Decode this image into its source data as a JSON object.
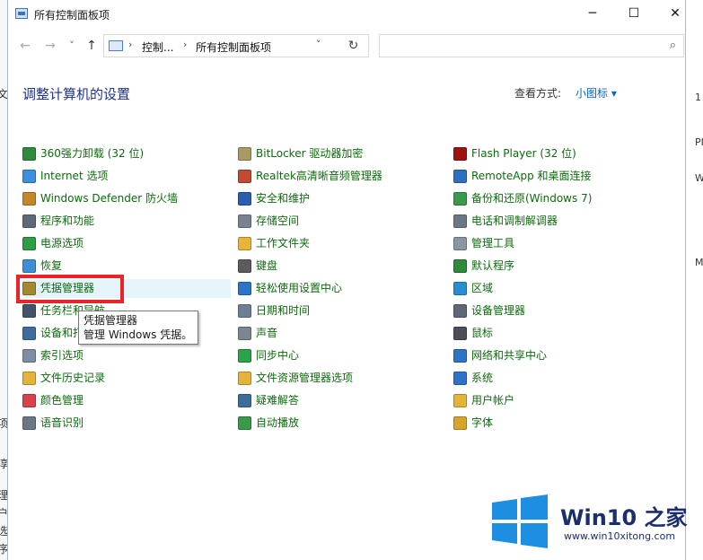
{
  "window": {
    "title": "所有控制面板项",
    "minimize": "─",
    "maximize": "☐",
    "close": "✕"
  },
  "nav": {
    "back": "←",
    "forward": "→",
    "recent": "˅",
    "up": "↑",
    "breadcrumb": [
      "控制...",
      "所有控制面板项"
    ],
    "separator": "›",
    "dropdown": "˅",
    "refresh": "↻",
    "search_placeholder": "",
    "search_icon": "⌕"
  },
  "header": {
    "title": "调整计算机的设置",
    "view_by_label": "查看方式:",
    "view_by_value": "小图标 ▾"
  },
  "items": [
    [
      "360强力卸载 (32 位)",
      "Internet 选项",
      "Windows Defender 防火墙",
      "程序和功能",
      "电源选项",
      "恢复",
      "凭据管理器",
      "任务栏和导航",
      "设备和打印机",
      "索引选项",
      "文件历史记录",
      "颜色管理",
      "语音识别"
    ],
    [
      "BitLocker 驱动器加密",
      "Realtek高清晰音频管理器",
      "安全和维护",
      "存储空间",
      "工作文件夹",
      "键盘",
      "轻松使用设置中心",
      "日期和时间",
      "声音",
      "同步中心",
      "文件资源管理器选项",
      "疑难解答",
      "自动播放"
    ],
    [
      "Flash Player (32 位)",
      "RemoteApp 和桌面连接",
      "备份和还原(Windows 7)",
      "电话和调制解调器",
      "管理工具",
      "默认程序",
      "区域",
      "设备管理器",
      "鼠标",
      "网络和共享中心",
      "系统",
      "用户帐户",
      "字体"
    ]
  ],
  "icons": [
    [
      "uninstall-icon",
      "internet-options-icon",
      "firewall-icon",
      "programs-icon",
      "power-icon",
      "recovery-icon",
      "credential-icon",
      "taskbar-icon",
      "printer-icon",
      "index-icon",
      "file-history-icon",
      "color-icon",
      "speech-icon"
    ],
    [
      "bitlocker-icon",
      "audio-manager-icon",
      "security-flag-icon",
      "storage-icon",
      "work-folders-icon",
      "keyboard-icon",
      "ease-of-access-icon",
      "date-time-icon",
      "sound-icon",
      "sync-icon",
      "explorer-options-icon",
      "troubleshoot-icon",
      "autoplay-icon"
    ],
    [
      "flash-icon",
      "remoteapp-icon",
      "backup-icon",
      "phone-modem-icon",
      "admin-tools-icon",
      "default-programs-icon",
      "region-icon",
      "device-manager-icon",
      "mouse-icon",
      "network-icon",
      "system-icon",
      "user-accounts-icon",
      "fonts-icon"
    ]
  ],
  "icon_colors": [
    [
      "#2f8a3a",
      "#3c8fdf",
      "#c4862b",
      "#5f6a78",
      "#2f9d44",
      "#3d8fd6",
      "#a5882f",
      "#44536a",
      "#3d6d9c",
      "#7e8ea2",
      "#e3b33a",
      "#d8424a",
      "#6b7786"
    ],
    [
      "#a99a64",
      "#c24a33",
      "#2a5fb0",
      "#7a8291",
      "#e7b43c",
      "#5c5c5c",
      "#2d74c8",
      "#6e7f95",
      "#7d8592",
      "#2aa34a",
      "#e3b33a",
      "#3d6d9c",
      "#3a9a4b"
    ],
    [
      "#9b1410",
      "#2f6fc0",
      "#3a9a4b",
      "#6b7786",
      "#8b96a4",
      "#2f8a3a",
      "#2a8dd0",
      "#5d6877",
      "#4a4f58",
      "#2d74c8",
      "#2d74c8",
      "#e3b33a",
      "#d6a52c"
    ]
  ],
  "tooltip": {
    "title": "凭据管理器",
    "description": "管理 Windows 凭据。"
  },
  "watermark": {
    "brand": "Win10 之家",
    "url": "www.win10xitong.com",
    "colors": {
      "logo": "#1e8fe0",
      "text": "#1b2f6e"
    }
  },
  "background_left": [
    "文",
    "项",
    "淳",
    "理",
    "户",
    "选",
    "序"
  ],
  "background_right": [
    "1",
    "PI",
    "W",
    "M"
  ],
  "colors": {
    "item_text": "#0c6b0c",
    "title": "#1e3287",
    "link": "#0066cc",
    "highlight": "#e8232a"
  }
}
